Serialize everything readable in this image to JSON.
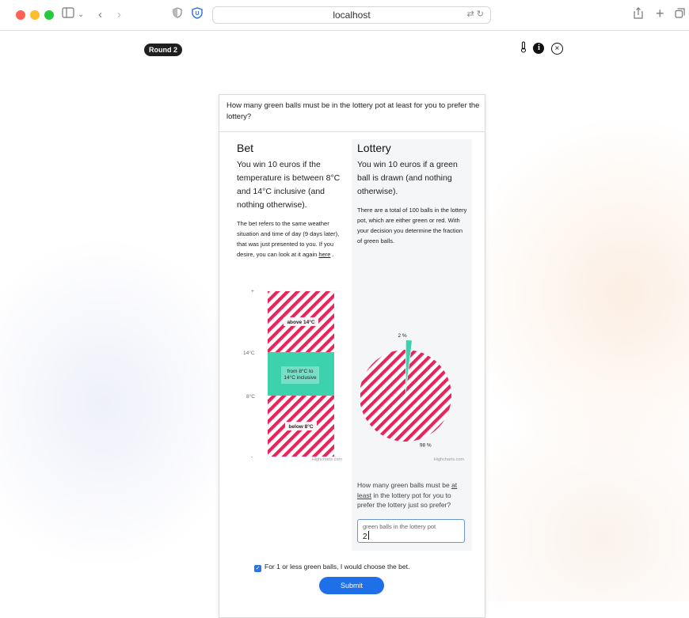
{
  "browser": {
    "url": "localhost"
  },
  "app": {
    "round_label": "Round 2"
  },
  "question": "How many green balls must be in the lottery pot at least for you to prefer the lottery?",
  "bet": {
    "title": "Bet",
    "main_text": "You win 10 euros if the temperature is between 8°C and 14°C inclusive (and nothing otherwise).",
    "detail_text": "The bet refers to the same weather situation and time of day (9 days later), that was just presented to you. If you desire, you can look at it again",
    "link_text": "here",
    "link_suffix": " ."
  },
  "lottery": {
    "title": "Lottery",
    "main_text": "You win 10 euros if a green ball is drawn (and nothing otherwise).",
    "detail_text": "There are a total of 100 balls in the lottery pot, which are either green or red. With your decision you determine the fraction of green balls."
  },
  "bottom_question": {
    "part1": "How many green balls must be ",
    "emph": "at least",
    "part2": " in the lottery pot for you to prefer the lottery just so prefer?"
  },
  "input": {
    "label": "green balls in the lottery pot",
    "value": "2"
  },
  "checkbox": {
    "checked": true,
    "label": "For 1 or less green balls, I would choose the bet."
  },
  "submit_label": "Submit",
  "colors": {
    "green": "#3cd2ad",
    "red": "#e8245a",
    "accent": "#1f6fe8"
  },
  "chart_data": [
    {
      "type": "bar",
      "stacked": true,
      "categories": [
        "below 8°C",
        "from 8°C to 14°C inclusive",
        "above 14°C"
      ],
      "segments": [
        {
          "label": "below 8°C",
          "from": "-",
          "to": "8°C",
          "pattern": "red-stripes"
        },
        {
          "label": "from 8°C to 14°C inclusive",
          "from": "8°C",
          "to": "14°C",
          "pattern": "green-solid"
        },
        {
          "label": "above 14°C",
          "from": "14°C",
          "to": "+",
          "pattern": "red-stripes"
        }
      ],
      "y_ticks": [
        "+",
        "14°C",
        "8°C",
        "-"
      ],
      "credit": "Highcharts.com"
    },
    {
      "type": "pie",
      "slices": [
        {
          "label": "2 %",
          "value": 2,
          "pattern": "green-solid"
        },
        {
          "label": "98 %",
          "value": 98,
          "pattern": "red-stripes"
        }
      ],
      "credit": "Highcharts.com"
    }
  ]
}
